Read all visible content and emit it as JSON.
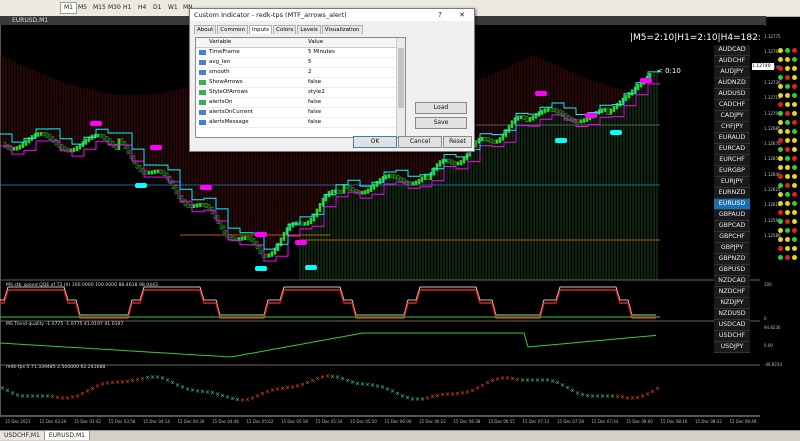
{
  "toolbar": {
    "timeframes": [
      "M1",
      "M5",
      "M15",
      "M30",
      "H1",
      "H4",
      "D1",
      "W1",
      "MN"
    ],
    "active_timeframe": "M1"
  },
  "chart": {
    "window_title": "EURUSD,M1",
    "top_info": "|M5=2:10|H1=2:10|H4=182:10",
    "countdown": "< 0:10",
    "price_ticks": [
      "1.12775",
      "1.12760",
      "1.12745",
      "1.12730",
      "1.12715",
      "1.12700",
      "1.12685",
      "1.12670",
      "1.12655",
      "1.12640",
      "1.12625",
      "1.12610",
      "1.12595",
      "1.12580"
    ],
    "current_price": "1.12740"
  },
  "pairs": [
    "AUDCAD",
    "AUDCHF",
    "AUDJPY",
    "AUDNZD",
    "AUDUSD",
    "CADCHF",
    "CADJPY",
    "CHFJPY",
    "EURAUD",
    "EURCAD",
    "EURCHF",
    "EURGBP",
    "EURJPY",
    "EURNZD",
    "EURUSD",
    "GBPAUD",
    "GBPCAD",
    "GBPCHF",
    "GBPJPY",
    "GBPNZD",
    "GBPUSD",
    "NZDCAD",
    "NZDCHF",
    "NZDJPY",
    "NZDUSD",
    "USDCAD",
    "USDCHF",
    "USDJPY"
  ],
  "active_pair": "EURUSD",
  "dialog": {
    "title": "Custom Indicator - redk-tps (MTF_arrows_alert)",
    "close_symbol": "✕",
    "help_symbol": "?",
    "tabs": [
      "About",
      "Common",
      "Inputs",
      "Colors",
      "Levels",
      "Visualization"
    ],
    "active_tab": "Inputs",
    "col_variable": "Variable",
    "col_value": "Value",
    "rows": [
      {
        "var": "TimeFrame",
        "val": "5 Minutes"
      },
      {
        "var": "avg_len",
        "val": "5"
      },
      {
        "var": "smooth",
        "val": "2"
      },
      {
        "var": "ShowArrows",
        "val": "false"
      },
      {
        "var": "StyleOfArrows",
        "val": "style2"
      },
      {
        "var": "alertsOn",
        "val": "false"
      },
      {
        "var": "alertsOnCurrent",
        "val": "false"
      },
      {
        "var": "alertsMessage",
        "val": "false"
      }
    ],
    "load": "Load",
    "save": "Save",
    "ok": "OK",
    "cancel": "Cancel",
    "reset": "Reset"
  },
  "subwindows": {
    "qqe_label": "MS stb_speed QQE of T3 (0) 100.0000 100.0000 88.4618 98.0443",
    "qqe_ticks": [
      "100",
      "0"
    ],
    "trend_label": "MS Trend quality -1.0775 -1.0775 41.0197 41.0197",
    "trend_ticks": [
      "94.8236",
      "0.00",
      "-46.8234"
    ],
    "redk_label": "redk-tps 5 71.339485 2.500000 62.241688",
    "redk_ticks": [
      "",
      "",
      ""
    ]
  },
  "dates": [
    "15 Dec 2021",
    "15 Dec 03:26",
    "15 Dec 03:42",
    "15 Dec 03:58",
    "15 Dec 04:14",
    "15 Dec 04:30",
    "15 Dec 04:46",
    "15 Dec 05:02",
    "15 Dec 05:18",
    "15 Dec 05:34",
    "15 Dec 05:50",
    "15 Dec 06:06",
    "15 Dec 06:22",
    "15 Dec 06:38",
    "15 Dec 06:55",
    "15 Dec 07:12",
    "15 Dec 07:28",
    "15 Dec 07:44",
    "15 Dec 08:00",
    "15 Dec 08:16",
    "15 Dec 08:32",
    "15 Dec 08:48"
  ],
  "bottom_tabs": [
    "USDCHF,M1",
    "EURUSD,M1"
  ],
  "active_bottom_tab": "EURUSD,M1",
  "colors": {
    "bull": "#2fd12f",
    "bear": "#e0201a",
    "magenta": "#ff00ff",
    "cyan": "#00ffff",
    "accent": "#1a6fb0"
  }
}
